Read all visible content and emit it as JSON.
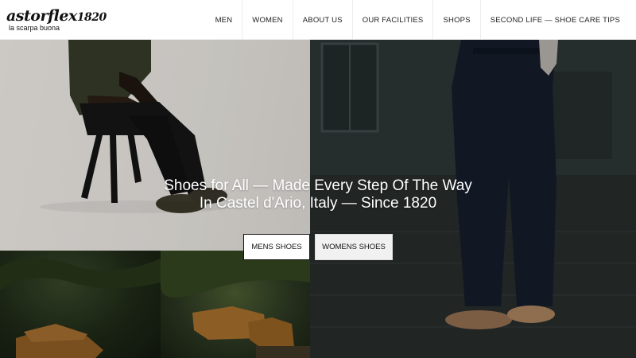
{
  "brand": {
    "name": "astorflex",
    "year": "1820",
    "tagline": "la scarpa buona"
  },
  "nav": {
    "items": [
      {
        "label": "MEN"
      },
      {
        "label": "WOMEN"
      },
      {
        "label": "ABOUT US"
      },
      {
        "label": "OUR FACILITIES"
      },
      {
        "label": "SHOPS"
      },
      {
        "label": "SECOND LIFE — SHOE CARE TIPS"
      }
    ]
  },
  "hero": {
    "title_line1": "Shoes for All — Made Every Step Of The Way",
    "title_line2": "In Castel d'Ario, Italy — Since 1820",
    "buttons": {
      "mens": "MENS SHOES",
      "womens": "WOMENS SHOES"
    }
  },
  "colors": {
    "header_bg": "#ffffff",
    "text_dark": "#111111",
    "hero_text": "#ffffff"
  }
}
